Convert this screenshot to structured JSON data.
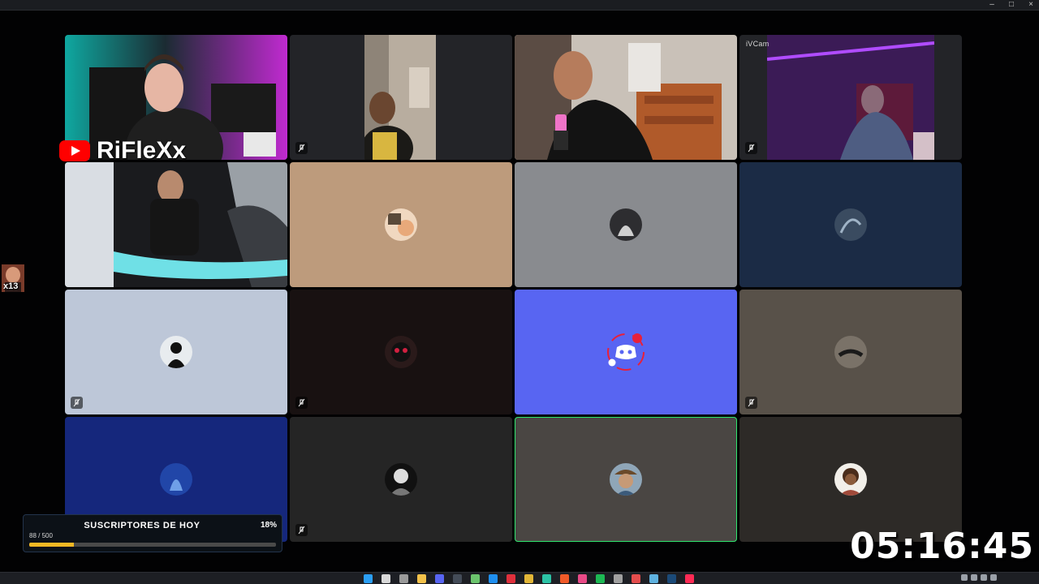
{
  "overlay": {
    "channel_name": "RiFleXx",
    "side_badge": "x13",
    "camera_label": "iVCam"
  },
  "subscribers_widget": {
    "title": "SUSCRIPTORES DE HOY",
    "percent": "18%",
    "count": "88 / 500",
    "progress": 0.18,
    "fill_color": "#f2b824"
  },
  "timer": "05:16:45",
  "tiles": [
    {
      "id": "r1c1",
      "type": "video",
      "speaking": true,
      "muted": false
    },
    {
      "id": "r1c2",
      "type": "video",
      "speaking": false,
      "muted": true
    },
    {
      "id": "r1c3",
      "type": "video",
      "speaking": false,
      "muted": false
    },
    {
      "id": "r1c4",
      "type": "video",
      "speaking": false,
      "muted": true
    },
    {
      "id": "r2c1",
      "type": "video",
      "speaking": false,
      "muted": false
    },
    {
      "id": "r2c2",
      "type": "avatar",
      "bg": "#bd9b7c",
      "speaking": false,
      "muted": false
    },
    {
      "id": "r2c3",
      "type": "avatar",
      "bg": "#898b8f",
      "speaking": false,
      "muted": false
    },
    {
      "id": "r2c4",
      "type": "avatar",
      "bg": "#1b2b45",
      "speaking": false,
      "muted": false
    },
    {
      "id": "r3c1",
      "type": "avatar",
      "bg": "#bdc7d8",
      "speaking": false,
      "muted": true
    },
    {
      "id": "r3c2",
      "type": "avatar",
      "bg": "#181111",
      "speaking": false,
      "muted": true
    },
    {
      "id": "r3c3",
      "type": "avatar-discord",
      "bg": "#5865f2",
      "speaking": false,
      "muted": false
    },
    {
      "id": "r3c4",
      "type": "avatar",
      "bg": "#585149",
      "speaking": false,
      "muted": true
    },
    {
      "id": "r4c1",
      "type": "avatar",
      "bg": "#15277c",
      "speaking": false,
      "muted": false
    },
    {
      "id": "r4c2",
      "type": "avatar",
      "bg": "#252525",
      "speaking": false,
      "muted": true
    },
    {
      "id": "r4c3",
      "type": "avatar",
      "bg": "#4a4643",
      "speaking": true,
      "muted": false
    },
    {
      "id": "r4c4",
      "type": "avatar",
      "bg": "#2d2a27",
      "speaking": false,
      "muted": false
    }
  ],
  "taskbar": {
    "icons": [
      "windows-start-icon",
      "search-icon",
      "task-view-icon",
      "file-explorer-icon",
      "discord-icon",
      "terminal-icon",
      "app-icon",
      "edge-icon",
      "opera-icon",
      "chrome-icon",
      "app-icon",
      "brave-icon",
      "app-icon",
      "spotify-icon",
      "app-icon",
      "app-icon",
      "app-icon",
      "steam-icon",
      "tiktok-icon"
    ],
    "icon_colors": [
      "#2b9ff4",
      "#d9d9d9",
      "#9a9a9a",
      "#f3c24a",
      "#5865f2",
      "#444c58",
      "#6bc46d",
      "#1f8ff0",
      "#e0303c",
      "#e2b637",
      "#2cc3a6",
      "#f05a28",
      "#e94a87",
      "#1db954",
      "#a0a0a0",
      "#e44d4d",
      "#5fb2e0",
      "#1b4a78",
      "#ff2b55"
    ]
  }
}
